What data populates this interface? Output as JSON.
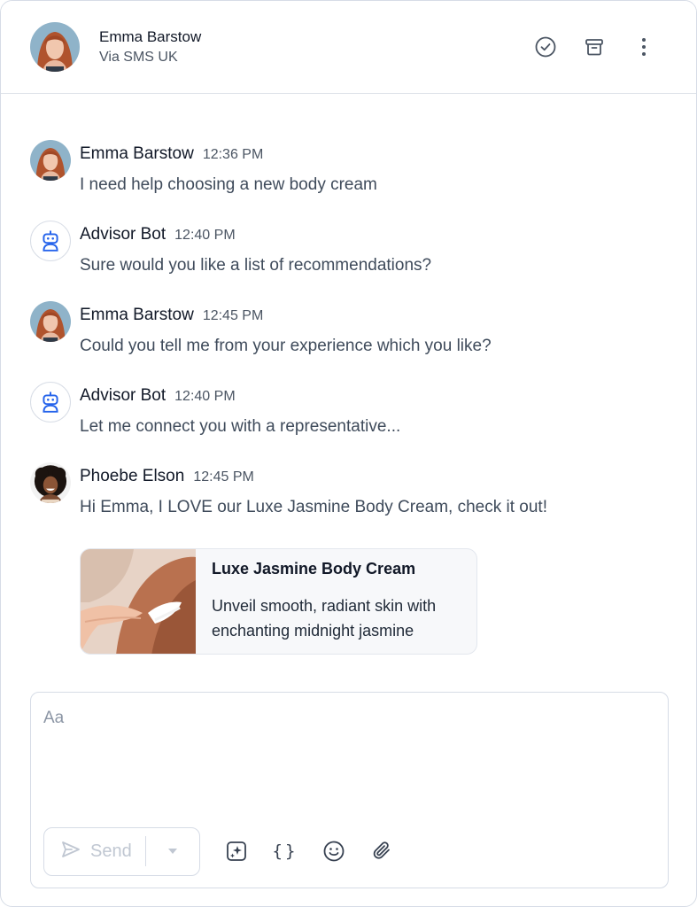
{
  "header": {
    "contact_name": "Emma Barstow",
    "channel": "Via SMS UK",
    "icons": [
      "check-circle-icon",
      "archive-icon",
      "more-vertical-icon"
    ]
  },
  "messages": [
    {
      "sender": "Emma Barstow",
      "time": "12:36 PM",
      "text": "I need help choosing a new body cream",
      "avatar": "emma"
    },
    {
      "sender": "Advisor Bot",
      "time": "12:40 PM",
      "text": "Sure would you like a list of recommendations?",
      "avatar": "bot"
    },
    {
      "sender": "Emma Barstow",
      "time": "12:45 PM",
      "text": "Could you tell me from your experience which you like?",
      "avatar": "emma"
    },
    {
      "sender": "Advisor Bot",
      "time": "12:40 PM",
      "text": "Let me connect you with a representative...",
      "avatar": "bot"
    },
    {
      "sender": "Phoebe Elson",
      "time": "12:45 PM",
      "text": "Hi Emma, I LOVE our Luxe Jasmine Body Cream, check it out!",
      "avatar": "phoebe"
    }
  ],
  "product_card": {
    "title": "Luxe Jasmine Body Cream",
    "description": "Unveil smooth, radiant skin with enchanting midnight jasmine"
  },
  "composer": {
    "placeholder": "Aa",
    "value": "",
    "send_label": "Send",
    "toolbar_icons": [
      "ai-sparkle-icon",
      "braces-icon",
      "emoji-icon",
      "paperclip-icon"
    ]
  },
  "colors": {
    "bot_icon": "#2563eb",
    "border": "#d6dce6",
    "muted_text": "#4b5563"
  }
}
